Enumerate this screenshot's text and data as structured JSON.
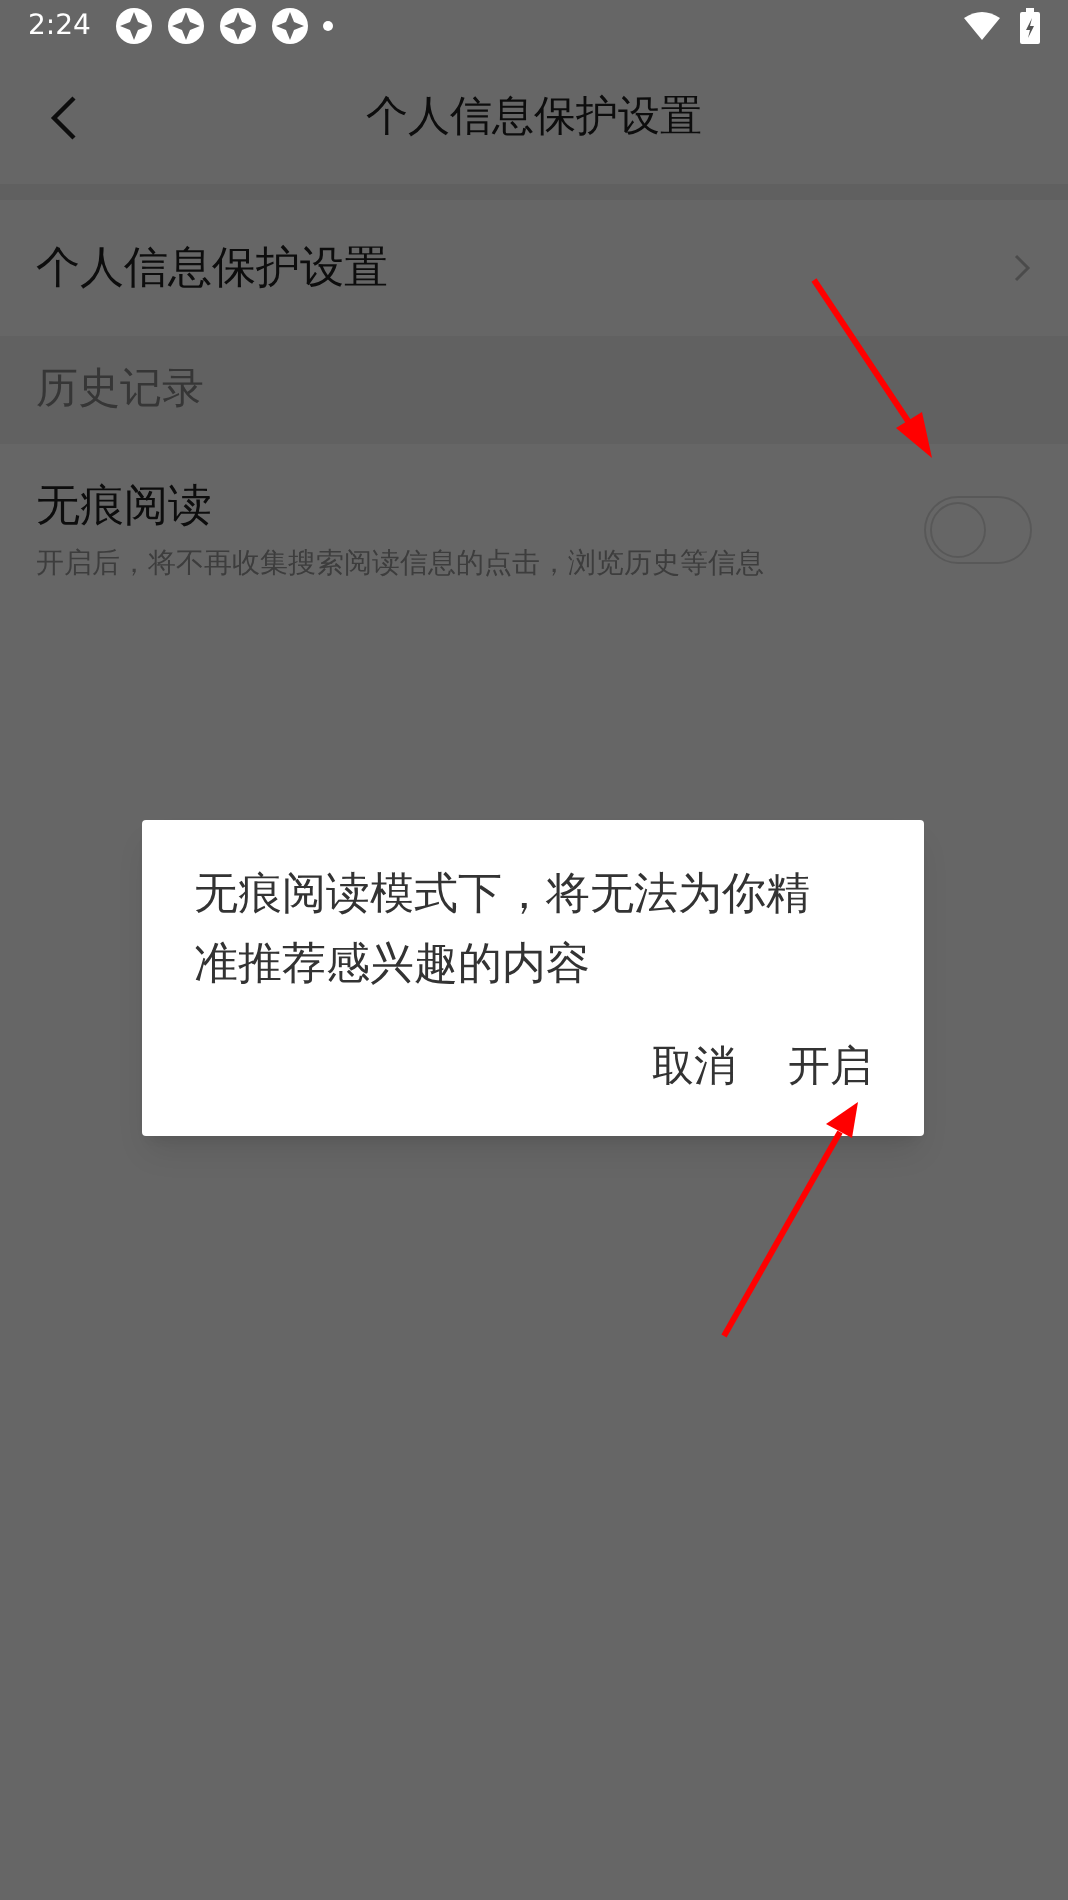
{
  "status_bar": {
    "time": "2:24"
  },
  "header": {
    "title": "个人信息保护设置"
  },
  "settings": [
    {
      "kind": "link",
      "label": "个人信息保护设置"
    },
    {
      "kind": "section",
      "label": "历史记录"
    },
    {
      "kind": "toggle",
      "label": "无痕阅读",
      "description": "开启后，将不再收集搜索阅读信息的点击，浏览历史等信息",
      "checked": false
    }
  ],
  "dialog": {
    "message": "无痕阅读模式下，将无法为你精准推荐感兴趣的内容",
    "buttons": [
      "取消",
      "开启"
    ]
  }
}
